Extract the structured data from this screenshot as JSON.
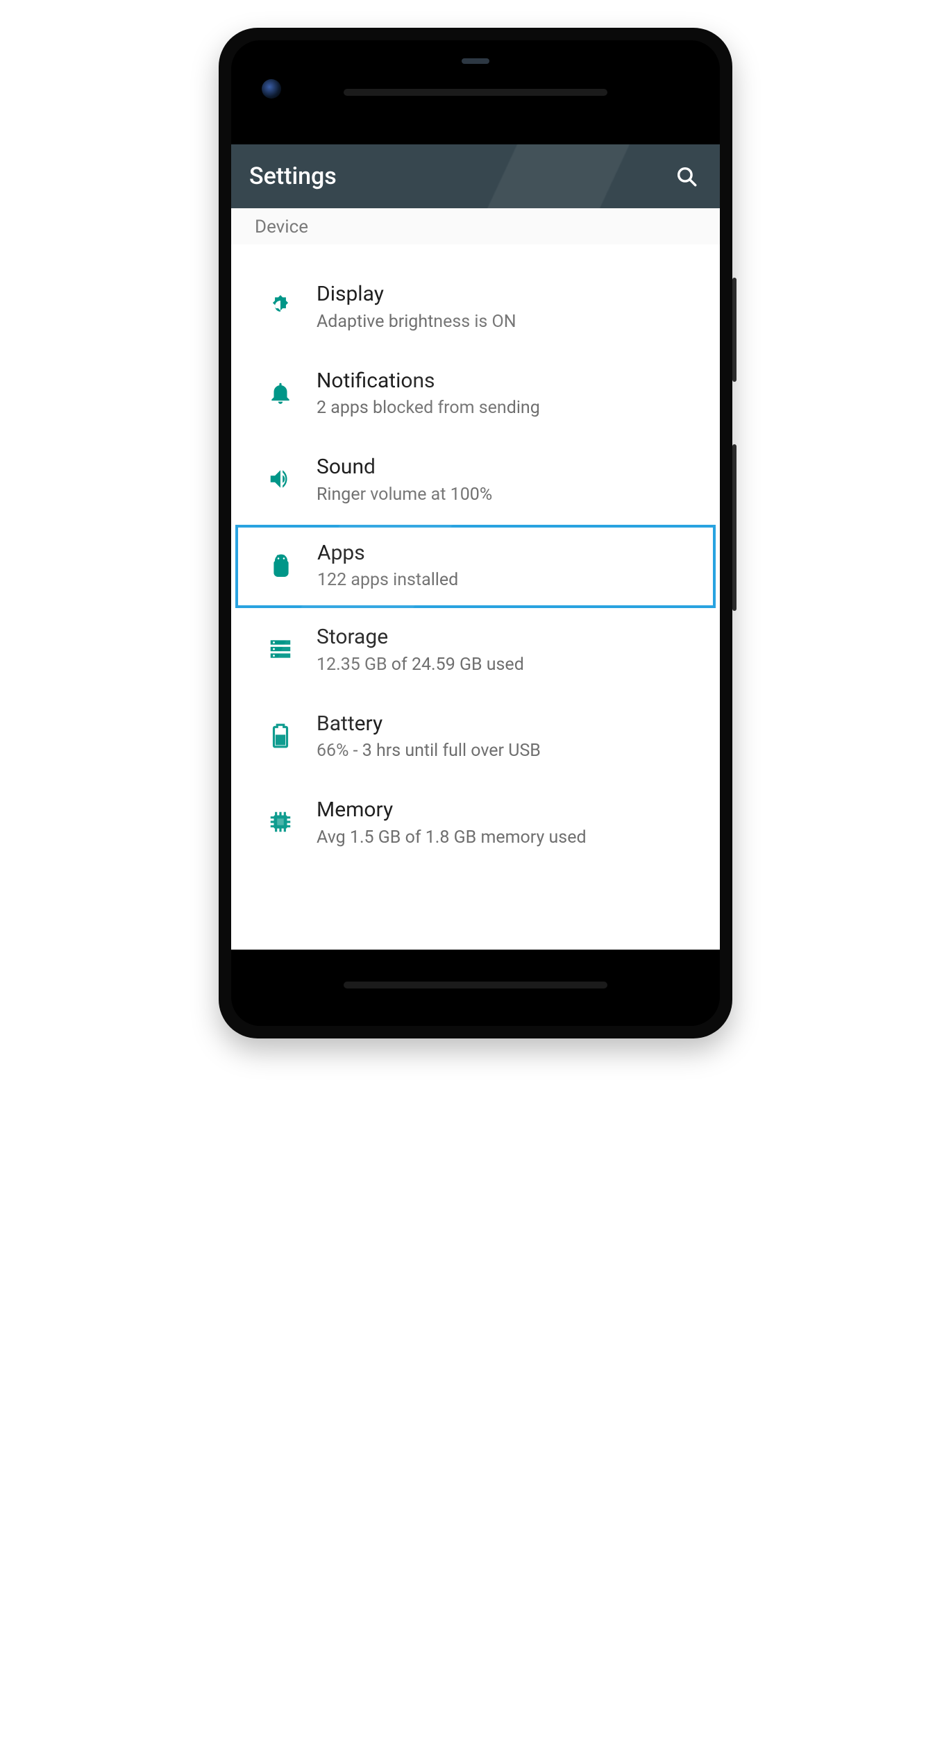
{
  "appbar": {
    "title": "Settings"
  },
  "section": {
    "label": "Device"
  },
  "colors": {
    "accent": "#009688",
    "highlight": "#29a3e0"
  },
  "rows": [
    {
      "icon": "brightness-icon",
      "title": "Display",
      "subtitle": "Adaptive brightness is ON",
      "highlight": false
    },
    {
      "icon": "bell-icon",
      "title": "Notifications",
      "subtitle": "2 apps blocked from sending",
      "highlight": false
    },
    {
      "icon": "volume-icon",
      "title": "Sound",
      "subtitle": "Ringer volume at 100%",
      "highlight": false
    },
    {
      "icon": "android-icon",
      "title": "Apps",
      "subtitle": "122 apps installed",
      "highlight": true
    },
    {
      "icon": "storage-icon",
      "title": "Storage",
      "subtitle": "12.35 GB of 24.59 GB used",
      "highlight": false
    },
    {
      "icon": "battery-icon",
      "title": "Battery",
      "subtitle": "66% - 3 hrs until full over USB",
      "highlight": false
    },
    {
      "icon": "memory-icon",
      "title": "Memory",
      "subtitle": "Avg 1.5 GB of 1.8 GB memory used",
      "highlight": false
    }
  ]
}
